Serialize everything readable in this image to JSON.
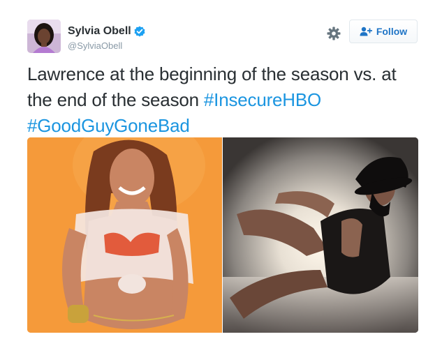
{
  "author": {
    "display_name": "Sylvia Obell",
    "handle": "@SylviaObell",
    "verified": true,
    "avatar_icon": "profile-photo"
  },
  "actions": {
    "settings_icon": "gear-icon",
    "follow_label": "Follow",
    "follow_icon": "add-user-icon"
  },
  "tweet": {
    "text_line1": "Lawrence at the beginning of the season vs. at",
    "text_line2_plain": "the end of the season",
    "hashtag1": "#InsecureHBO",
    "hashtag2": "#GoodGuyGoneBad"
  },
  "media": {
    "photos": [
      {
        "icon": "photo-woman-orange-background"
      },
      {
        "icon": "photo-woman-black-hat-smoky-background"
      }
    ]
  },
  "colors": {
    "hashtag": "#1b95e0",
    "follow_text": "#1f75c6",
    "verified_badge": "#1da1f2",
    "left_photo_bg": "#f59a3a"
  }
}
